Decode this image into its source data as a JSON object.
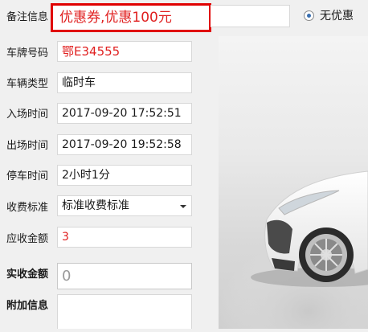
{
  "form": {
    "remark": {
      "label": "备注信息",
      "value": "优惠券,优惠100元"
    },
    "no_discount_label": "无优惠",
    "plate": {
      "label": "车牌号码",
      "value": "鄂E34555"
    },
    "vehicle_type": {
      "label": "车辆类型",
      "value": "临时车"
    },
    "entry_time": {
      "label": "入场时间",
      "value": "2017-09-20 17:52:51"
    },
    "exit_time": {
      "label": "出场时间",
      "value": "2017-09-20 19:52:58"
    },
    "parking_time": {
      "label": "停车时间",
      "value": "2小时1分"
    },
    "fee_standard": {
      "label": "收费标准",
      "value": "标准收费标准"
    },
    "receivable": {
      "label": "应收金额",
      "value": "3"
    },
    "actual": {
      "label": "实收金额",
      "placeholder": "0"
    },
    "extra": {
      "label": "附加信息"
    }
  },
  "colors": {
    "highlight_border": "#e00000",
    "value_red": "#e02020"
  },
  "icons": {
    "photo": "car-photo"
  }
}
